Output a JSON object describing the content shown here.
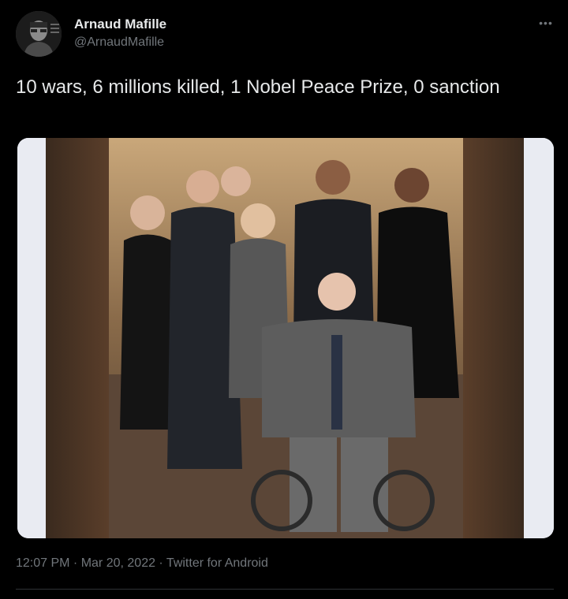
{
  "author": {
    "name": "Arnaud Mafille",
    "handle": "@ArnaudMafille",
    "avatar_icon": "user-avatar-icon"
  },
  "menu": {
    "icon": "more-horizontal-icon",
    "glyph": "•••"
  },
  "tweet": {
    "text": "10 wars, 6 millions killed, 1 Nobel Peace Prize, 0 sanction"
  },
  "media": {
    "kind": "photo"
  },
  "meta": {
    "time": "12:07 PM",
    "separator": " · ",
    "date": "Mar 20, 2022",
    "source": "Twitter for Android"
  },
  "colors": {
    "background": "#000000",
    "text": "#e7e9ea",
    "secondary": "#71767b",
    "divider": "#2f3336"
  }
}
